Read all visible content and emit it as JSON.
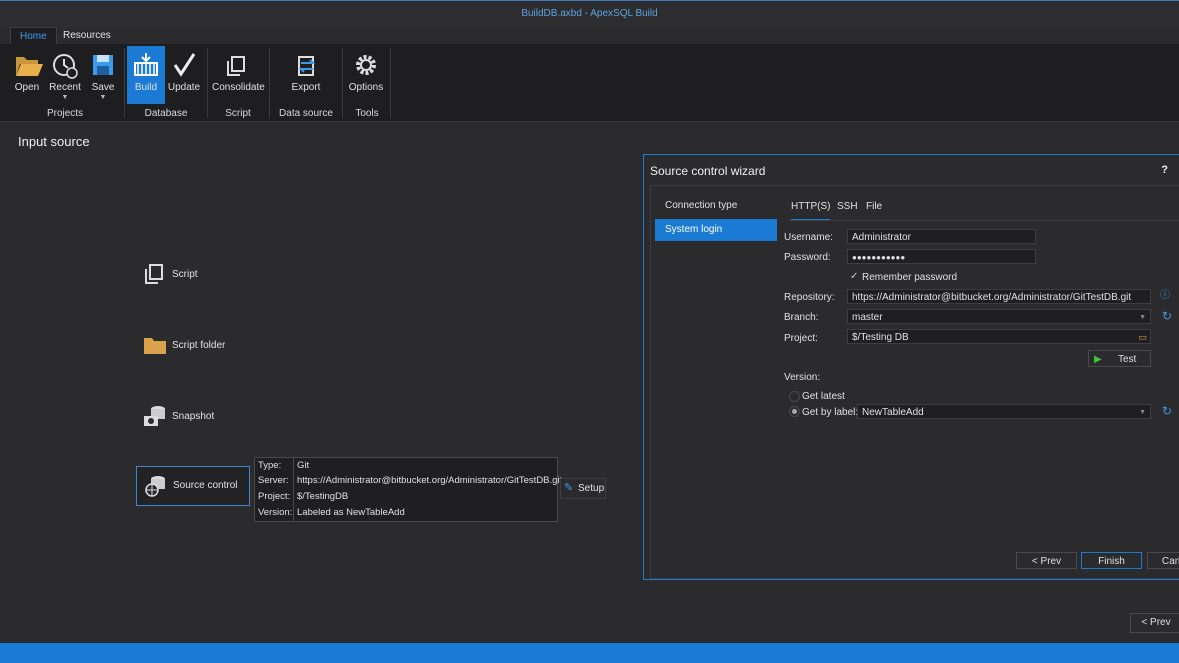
{
  "window": {
    "title": "BuildDB.axbd - ApexSQL Build"
  },
  "tabs": [
    {
      "label": "Home"
    },
    {
      "label": "Resources"
    }
  ],
  "ribbon": {
    "buttons": {
      "open": "Open",
      "recent": "Recent",
      "save": "Save",
      "build": "Build",
      "update": "Update",
      "consolidate": "Consolidate",
      "export": "Export",
      "options": "Options"
    },
    "groups": {
      "projects": "Projects",
      "database": "Database",
      "script": "Script",
      "data_source": "Data source",
      "tools": "Tools"
    }
  },
  "page": {
    "heading": "Input source"
  },
  "sources": {
    "script": "Script",
    "script_folder": "Script folder",
    "snapshot": "Snapshot",
    "source_control": "Source control"
  },
  "source_info": {
    "rows": [
      {
        "key": "Type:",
        "value": "Git"
      },
      {
        "key": "Server:",
        "value": "https://Administrator@bitbucket.org/Administrator/GitTestDB.git"
      },
      {
        "key": "Project:",
        "value": "$/TestingDB"
      },
      {
        "key": "Version:",
        "value": "Labeled as NewTableAdd"
      }
    ],
    "setup_label": "Setup"
  },
  "wizard": {
    "title": "Source control wizard",
    "help": "?",
    "steps": [
      "Connection type",
      "System login"
    ],
    "tabs": [
      "HTTP(S)",
      "SSH",
      "File"
    ],
    "fields": {
      "username_label": "Username:",
      "username": "Administrator",
      "password_label": "Password:",
      "password": "●●●●●●●●●●●",
      "remember_label": "Remember password",
      "repository_label": "Repository:",
      "repository": "https://Administrator@bitbucket.org/Administrator/GitTestDB.git",
      "branch_label": "Branch:",
      "branch": "master",
      "project_label": "Project:",
      "project": "$/Testing DB",
      "test_label": "Test",
      "version_label": "Version:",
      "get_latest_label": "Get latest",
      "get_by_label_label": "Get by label:",
      "label_value": "NewTableAdd"
    },
    "buttons": {
      "prev": "< Prev",
      "finish": "Finish",
      "cancel": "Cancel"
    }
  },
  "footer": {
    "prev": "< Prev"
  },
  "colors": {
    "accent": "#1b7ad4",
    "background": "#2b2b2e",
    "ribbon": "#1e1e20"
  }
}
